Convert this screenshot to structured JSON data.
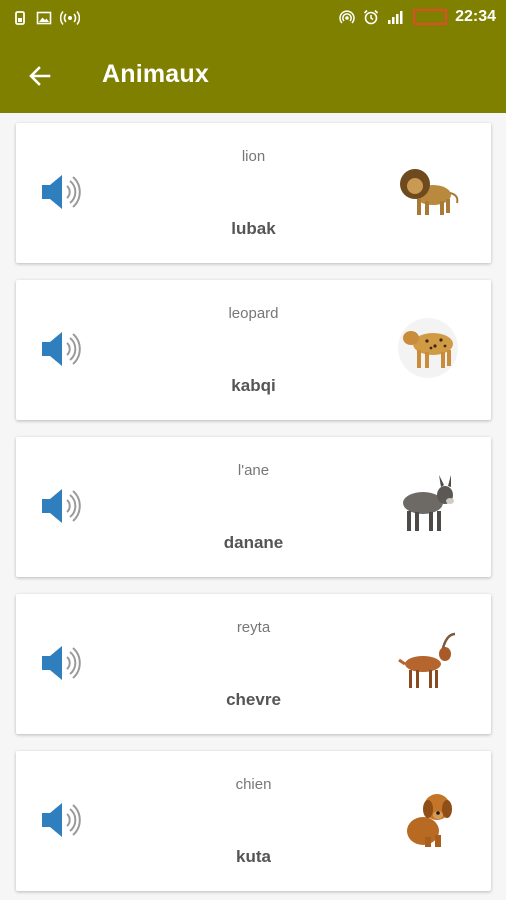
{
  "status_bar": {
    "time": "22:34",
    "battery_label": "",
    "left_icons": [
      "sim-icon",
      "image-icon",
      "broadcast-icon"
    ],
    "right_icons": [
      "hotspot-icon",
      "alarm-icon",
      "signal-icon",
      "battery-icon"
    ]
  },
  "app_bar": {
    "title": "Animaux",
    "background_color": "#7f7f00",
    "back_icon": "arrow-left-icon"
  },
  "cards": [
    {
      "top": "lion",
      "bottom": "lubak",
      "image": "lion"
    },
    {
      "top": "leopard",
      "bottom": "kabqi",
      "image": "leopard"
    },
    {
      "top": "l'ane",
      "bottom": "danane",
      "image": "donkey"
    },
    {
      "top": "reyta",
      "bottom": "chevre",
      "image": "goat"
    },
    {
      "top": "chien",
      "bottom": "kuta",
      "image": "dog"
    }
  ],
  "speaker_color": "#2f7fbf"
}
